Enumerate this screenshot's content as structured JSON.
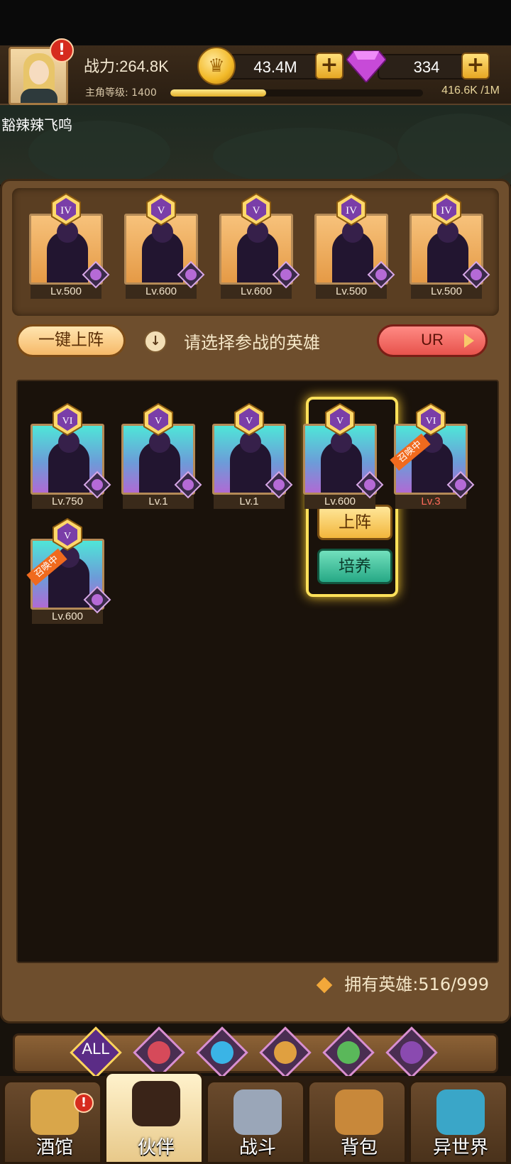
{
  "header": {
    "power_label": "战力:264.8K",
    "gold": "43.4M",
    "gems": "334",
    "level_label": "主角等级:",
    "level_value": "1400",
    "xp_text": "416.6K /1M",
    "xp_progress": 0.38,
    "username": "豁辣辣飞鸣",
    "alert_glyph": "!"
  },
  "team": [
    {
      "rank": "IV",
      "level": "Lv.500"
    },
    {
      "rank": "V",
      "level": "Lv.600"
    },
    {
      "rank": "V",
      "level": "Lv.600"
    },
    {
      "rank": "IV",
      "level": "Lv.500"
    },
    {
      "rank": "IV",
      "level": "Lv.500"
    }
  ],
  "actions": {
    "one_click": "一键上阵",
    "hint": "请选择参战的英雄",
    "rarity_filter": "UR"
  },
  "heroes": [
    {
      "rank": "VI",
      "level": "Lv.750",
      "summon": ""
    },
    {
      "rank": "V",
      "level": "Lv.1",
      "summon": ""
    },
    {
      "rank": "V",
      "level": "Lv.1",
      "summon": ""
    },
    {
      "rank": "V",
      "level": "Lv.600",
      "summon": ""
    },
    {
      "rank": "VI",
      "level": "Lv.3",
      "summon": "召唤中"
    },
    {
      "rank": "V",
      "level": "Lv.600",
      "summon": "召唤中"
    }
  ],
  "hero_menu": {
    "deploy": "上阵",
    "train": "培养"
  },
  "owned": "拥有英雄:516/999",
  "filters": [
    {
      "label": "ALL",
      "icon": "all-filter"
    },
    {
      "label": "",
      "icon": "knight-helmet-icon"
    },
    {
      "label": "",
      "icon": "water-creature-icon"
    },
    {
      "label": "",
      "icon": "lion-icon"
    },
    {
      "label": "",
      "icon": "elf-icon"
    },
    {
      "label": "",
      "icon": "demon-icon"
    }
  ],
  "nav": [
    {
      "label": "酒馆",
      "icon": "beer-mug-icon"
    },
    {
      "label": "伙伴",
      "icon": "partner-portrait-icon"
    },
    {
      "label": "战斗",
      "icon": "crossed-swords-icon"
    },
    {
      "label": "背包",
      "icon": "treasure-chest-icon"
    },
    {
      "label": "异世界",
      "icon": "portal-icon"
    }
  ]
}
